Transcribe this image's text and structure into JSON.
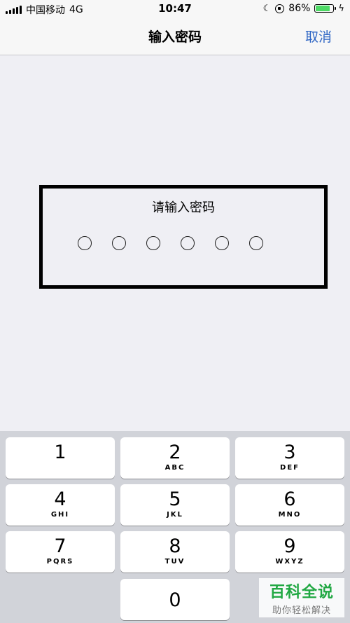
{
  "status_bar": {
    "carrier": "中国移动",
    "network": "4G",
    "time": "10:47",
    "battery_text": "86%",
    "battery_level": 0.86,
    "battery_color": "#4cd964",
    "icons": [
      "signal-icon",
      "moon-icon",
      "rotation-lock-icon",
      "battery-icon",
      "charging-icon"
    ]
  },
  "nav": {
    "title": "输入密码",
    "cancel_label": "取消",
    "accent_color": "#2f66c4"
  },
  "pin": {
    "prompt": "请输入密码",
    "length": 6,
    "entered": 0
  },
  "keypad": {
    "keys": [
      {
        "digit": "1",
        "letters": ""
      },
      {
        "digit": "2",
        "letters": "ABC"
      },
      {
        "digit": "3",
        "letters": "DEF"
      },
      {
        "digit": "4",
        "letters": "GHI"
      },
      {
        "digit": "5",
        "letters": "JKL"
      },
      {
        "digit": "6",
        "letters": "MNO"
      },
      {
        "digit": "7",
        "letters": "PQRS"
      },
      {
        "digit": "8",
        "letters": "TUV"
      },
      {
        "digit": "9",
        "letters": "WXYZ"
      },
      {
        "digit": "0",
        "letters": ""
      }
    ]
  },
  "watermark": {
    "title": "百科全说",
    "subtitle": "助你轻松解决",
    "color": "#21a843"
  }
}
